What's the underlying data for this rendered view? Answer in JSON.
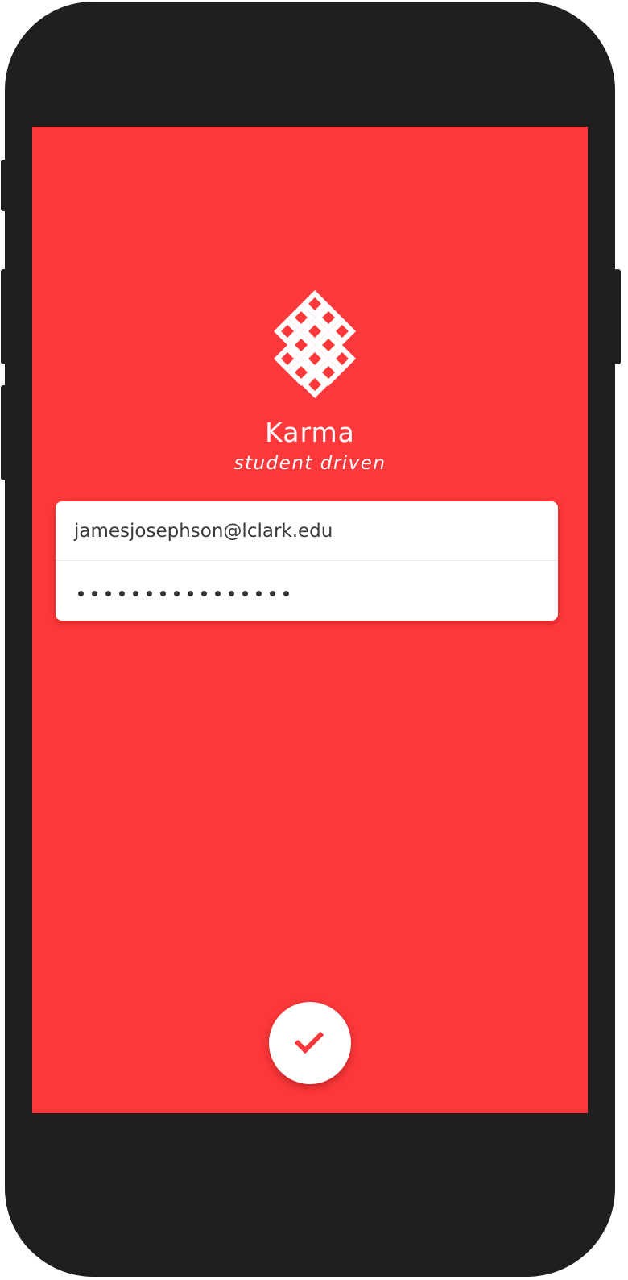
{
  "app": {
    "name": "Karma",
    "tagline": "student driven",
    "brand_color": "#fc383a",
    "logo_icon": "endless-knot-icon"
  },
  "login": {
    "email_value": "jamesjosephson@lclark.edu",
    "password_masked_length": 16
  },
  "submit": {
    "icon": "checkmark-icon",
    "icon_color": "#fc383a"
  }
}
